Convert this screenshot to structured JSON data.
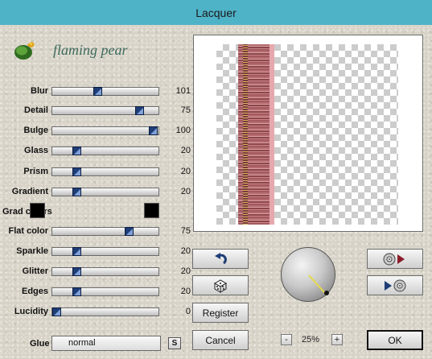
{
  "window": {
    "title": "Lacquer"
  },
  "brand": {
    "name": "flaming pear"
  },
  "sliders": [
    {
      "label": "Blur",
      "value": "101",
      "fraction": 0.42
    },
    {
      "label": "Detail",
      "value": "75",
      "fraction": 0.85
    },
    {
      "label": "Bulge",
      "value": "100",
      "fraction": 0.99
    },
    {
      "label": "Glass",
      "value": "20",
      "fraction": 0.21
    },
    {
      "label": "Prism",
      "value": "20",
      "fraction": 0.21
    },
    {
      "label": "Gradient",
      "value": "20",
      "fraction": 0.21
    },
    {
      "label": "Flat color",
      "value": "75",
      "fraction": 0.74
    },
    {
      "label": "Sparkle",
      "value": "20",
      "fraction": 0.21
    },
    {
      "label": "Glitter",
      "value": "20",
      "fraction": 0.21
    },
    {
      "label": "Edges",
      "value": "20",
      "fraction": 0.21
    },
    {
      "label": "Lucidity",
      "value": "0",
      "fraction": 0.0
    }
  ],
  "grad_colors": {
    "label": "Grad colors",
    "color1": "#000000",
    "color2": "#000000"
  },
  "glue": {
    "label": "Glue",
    "value": "normal",
    "button_label": "S"
  },
  "buttons": {
    "register": "Register",
    "cancel": "Cancel",
    "ok": "OK"
  },
  "zoom": {
    "minus": "-",
    "plus": "+",
    "value": "25%"
  },
  "icons": {
    "undo": "undo-arrow-icon",
    "random": "dice-icon",
    "load": "load-preset-icon",
    "save": "save-preset-icon"
  },
  "colors": {
    "titlebar": "#4fb3c8",
    "slider_thumb": "#1f3d77"
  }
}
